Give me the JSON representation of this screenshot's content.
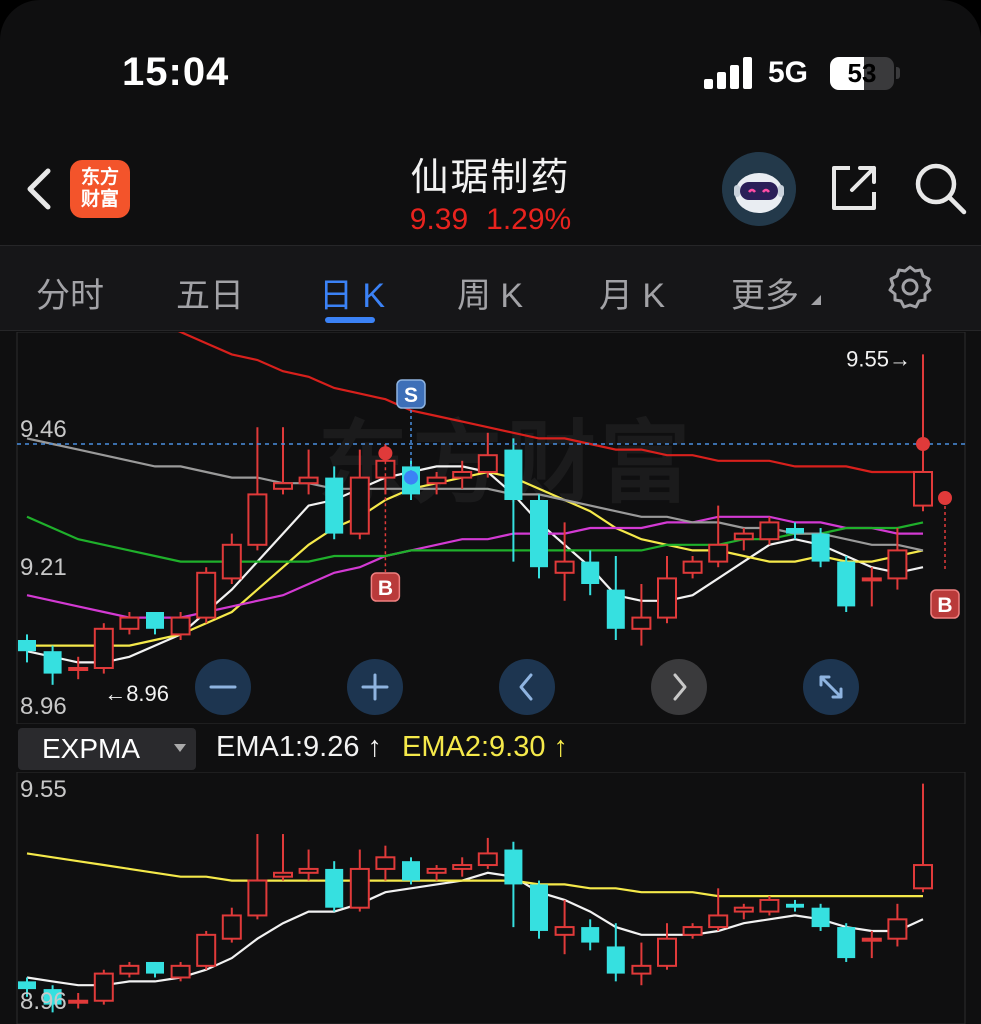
{
  "status_bar": {
    "time": "15:04",
    "network": "5G",
    "battery": "53",
    "battery_level": 0.53
  },
  "header": {
    "logo_line1": "东方",
    "logo_line2": "财富",
    "stock_name": "仙琚制药",
    "price": "9.39",
    "change_pct": "1.29%",
    "watermark": "东方财富",
    "accent_color": "#e8231e"
  },
  "tabs": [
    {
      "label": "分时",
      "active": false
    },
    {
      "label": "五日",
      "active": false
    },
    {
      "label": "日 K",
      "active": true
    },
    {
      "label": "周 K",
      "active": false
    },
    {
      "label": "月 K",
      "active": false
    },
    {
      "label": "更多",
      "active": false
    }
  ],
  "main_chart": {
    "price_high_label": "9.46",
    "price_mid_label": "9.21",
    "price_low_label": "8.96",
    "max_marker": "9.55→",
    "min_marker": "←8.96",
    "sell_marker": "S",
    "buy_marker": "B",
    "current_price_line": 9.39,
    "y_range": [
      8.89,
      9.59
    ],
    "up_color": "#e03a3a",
    "down_color": "#36e0e0"
  },
  "controls": [
    "zoom-out",
    "zoom-in",
    "previous",
    "next",
    "fullscreen"
  ],
  "indicator": {
    "name": "EXPMA",
    "ema1": "EMA1:9.26",
    "ema2": "EMA2:9.30",
    "ema1_color": "#f2f2f2",
    "ema2_color": "#f5e94a"
  },
  "sub_chart": {
    "price_high_label": "9.55",
    "price_low_label": "8.96",
    "y_range": [
      8.93,
      9.58
    ]
  },
  "candles": [
    {
      "o": 9.04,
      "c": 9.02,
      "h": 9.05,
      "l": 9.0
    },
    {
      "o": 9.02,
      "c": 8.98,
      "h": 9.03,
      "l": 8.96
    },
    {
      "o": 8.99,
      "c": 8.99,
      "h": 9.01,
      "l": 8.97
    },
    {
      "o": 8.99,
      "c": 9.06,
      "h": 9.07,
      "l": 8.98
    },
    {
      "o": 9.06,
      "c": 9.08,
      "h": 9.09,
      "l": 9.05
    },
    {
      "o": 9.09,
      "c": 9.06,
      "h": 9.09,
      "l": 9.05
    },
    {
      "o": 9.05,
      "c": 9.08,
      "h": 9.09,
      "l": 9.04
    },
    {
      "o": 9.08,
      "c": 9.16,
      "h": 9.17,
      "l": 9.07
    },
    {
      "o": 9.15,
      "c": 9.21,
      "h": 9.23,
      "l": 9.14
    },
    {
      "o": 9.21,
      "c": 9.3,
      "h": 9.42,
      "l": 9.2
    },
    {
      "o": 9.31,
      "c": 9.32,
      "h": 9.42,
      "l": 9.3
    },
    {
      "o": 9.32,
      "c": 9.33,
      "h": 9.38,
      "l": 9.3
    },
    {
      "o": 9.33,
      "c": 9.23,
      "h": 9.35,
      "l": 9.22
    },
    {
      "o": 9.23,
      "c": 9.33,
      "h": 9.38,
      "l": 9.22
    },
    {
      "o": 9.33,
      "c": 9.36,
      "h": 9.39,
      "l": 9.3
    },
    {
      "o": 9.35,
      "c": 9.3,
      "h": 9.36,
      "l": 9.29
    },
    {
      "o": 9.32,
      "c": 9.33,
      "h": 9.34,
      "l": 9.3
    },
    {
      "o": 9.33,
      "c": 9.34,
      "h": 9.36,
      "l": 9.31
    },
    {
      "o": 9.34,
      "c": 9.37,
      "h": 9.41,
      "l": 9.33
    },
    {
      "o": 9.38,
      "c": 9.29,
      "h": 9.4,
      "l": 9.18
    },
    {
      "o": 9.29,
      "c": 9.17,
      "h": 9.3,
      "l": 9.15
    },
    {
      "o": 9.16,
      "c": 9.18,
      "h": 9.25,
      "l": 9.11
    },
    {
      "o": 9.18,
      "c": 9.14,
      "h": 9.2,
      "l": 9.12
    },
    {
      "o": 9.13,
      "c": 9.06,
      "h": 9.19,
      "l": 9.04
    },
    {
      "o": 9.06,
      "c": 9.08,
      "h": 9.14,
      "l": 9.03
    },
    {
      "o": 9.08,
      "c": 9.15,
      "h": 9.19,
      "l": 9.07
    },
    {
      "o": 9.16,
      "c": 9.18,
      "h": 9.19,
      "l": 9.15
    },
    {
      "o": 9.18,
      "c": 9.21,
      "h": 9.28,
      "l": 9.17
    },
    {
      "o": 9.22,
      "c": 9.23,
      "h": 9.24,
      "l": 9.2
    },
    {
      "o": 9.22,
      "c": 9.25,
      "h": 9.26,
      "l": 9.21
    },
    {
      "o": 9.24,
      "c": 9.23,
      "h": 9.25,
      "l": 9.22
    },
    {
      "o": 9.23,
      "c": 9.18,
      "h": 9.24,
      "l": 9.17
    },
    {
      "o": 9.18,
      "c": 9.1,
      "h": 9.19,
      "l": 9.09
    },
    {
      "o": 9.15,
      "c": 9.15,
      "h": 9.17,
      "l": 9.1
    },
    {
      "o": 9.15,
      "c": 9.2,
      "h": 9.24,
      "l": 9.13
    },
    {
      "o": 9.28,
      "c": 9.34,
      "h": 9.55,
      "l": 9.27
    }
  ],
  "ma_lines": [
    {
      "color": "#f2f2f2",
      "values": [
        9.02,
        9.01,
        9.0,
        9.0,
        9.01,
        9.03,
        9.05,
        9.09,
        9.13,
        9.18,
        9.23,
        9.28,
        9.29,
        9.31,
        9.33,
        9.34,
        9.35,
        9.35,
        9.34,
        9.3,
        9.25,
        9.21,
        9.17,
        9.12,
        9.11,
        9.11,
        9.12,
        9.15,
        9.18,
        9.21,
        9.22,
        9.21,
        9.19,
        9.17,
        9.16,
        9.17
      ]
    },
    {
      "color": "#f5e94a",
      "values": [
        9.03,
        9.03,
        9.03,
        9.03,
        9.03,
        9.04,
        9.05,
        9.07,
        9.09,
        9.13,
        9.17,
        9.21,
        9.24,
        9.26,
        9.29,
        9.31,
        9.32,
        9.33,
        9.34,
        9.33,
        9.31,
        9.29,
        9.27,
        9.24,
        9.22,
        9.21,
        9.2,
        9.2,
        9.19,
        9.18,
        9.18,
        9.19,
        9.18,
        9.18,
        9.19,
        9.2
      ]
    },
    {
      "color": "#d33ad3",
      "values": [
        9.12,
        9.11,
        9.1,
        9.09,
        9.08,
        9.08,
        9.08,
        9.09,
        9.1,
        9.11,
        9.12,
        9.14,
        9.16,
        9.17,
        9.19,
        9.2,
        9.21,
        9.22,
        9.22,
        9.23,
        9.23,
        9.23,
        9.24,
        9.24,
        9.24,
        9.25,
        9.25,
        9.26,
        9.26,
        9.26,
        9.25,
        9.25,
        9.24,
        9.24,
        9.23,
        9.23
      ]
    },
    {
      "color": "#1fb02b",
      "values": [
        9.26,
        9.24,
        9.22,
        9.21,
        9.2,
        9.19,
        9.18,
        9.18,
        9.18,
        9.18,
        9.18,
        9.18,
        9.19,
        9.19,
        9.19,
        9.2,
        9.2,
        9.2,
        9.2,
        9.2,
        9.2,
        9.2,
        9.2,
        9.2,
        9.2,
        9.21,
        9.21,
        9.21,
        9.22,
        9.22,
        9.23,
        9.23,
        9.24,
        9.24,
        9.24,
        9.25
      ]
    },
    {
      "color": "#9a9a9a",
      "values": [
        9.4,
        9.39,
        9.38,
        9.37,
        9.36,
        9.35,
        9.35,
        9.34,
        9.33,
        9.33,
        9.32,
        9.32,
        9.31,
        9.31,
        9.31,
        9.31,
        9.31,
        9.31,
        9.31,
        9.3,
        9.3,
        9.29,
        9.28,
        9.27,
        9.26,
        9.26,
        9.25,
        9.25,
        9.24,
        9.24,
        9.23,
        9.23,
        9.22,
        9.21,
        9.21,
        9.2
      ]
    },
    {
      "color": "#d8201c",
      "values": [
        9.71,
        9.69,
        9.67,
        9.65,
        9.63,
        9.61,
        9.59,
        9.57,
        9.55,
        9.54,
        9.52,
        9.51,
        9.49,
        9.48,
        9.47,
        9.45,
        9.44,
        9.43,
        9.42,
        9.41,
        9.4,
        9.4,
        9.39,
        9.38,
        9.38,
        9.37,
        9.37,
        9.36,
        9.36,
        9.36,
        9.35,
        9.35,
        9.35,
        9.34,
        9.34,
        9.34
      ]
    }
  ],
  "ema_lines": [
    {
      "color": "#f2f2f2",
      "values": [
        9.05,
        9.04,
        9.03,
        9.03,
        9.04,
        9.04,
        9.05,
        9.07,
        9.1,
        9.15,
        9.19,
        9.22,
        9.22,
        9.24,
        9.27,
        9.28,
        9.29,
        9.3,
        9.32,
        9.31,
        9.27,
        9.25,
        9.22,
        9.18,
        9.16,
        9.16,
        9.16,
        9.17,
        9.19,
        9.2,
        9.21,
        9.2,
        9.18,
        9.17,
        9.17,
        9.2
      ]
    },
    {
      "color": "#f5e94a",
      "values": [
        9.37,
        9.36,
        9.35,
        9.34,
        9.33,
        9.32,
        9.31,
        9.31,
        9.3,
        9.3,
        9.3,
        9.3,
        9.3,
        9.3,
        9.3,
        9.3,
        9.3,
        9.3,
        9.3,
        9.3,
        9.29,
        9.29,
        9.28,
        9.28,
        9.27,
        9.27,
        9.27,
        9.26,
        9.26,
        9.26,
        9.26,
        9.26,
        9.26,
        9.26,
        9.26,
        9.26
      ]
    }
  ]
}
